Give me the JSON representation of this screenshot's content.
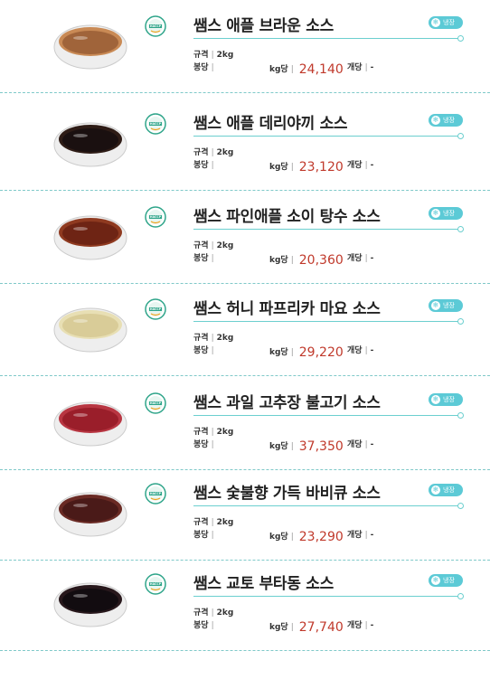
{
  "labels": {
    "spec": "규격",
    "bag": "봉당",
    "per_kg": "kg당",
    "per_each": "개당",
    "dash": "-",
    "haccp": "HACCP"
  },
  "products": [
    {
      "name": "쌤스 애플 브라운 소스",
      "spec": "2kg",
      "price": "24,140",
      "storage": "냉장",
      "sauce_color": "#a0643a",
      "rim_color": "#c98a55"
    },
    {
      "name": "쌤스 애플 데리야끼 소스",
      "spec": "2kg",
      "price": "23,120",
      "storage": "냉장",
      "sauce_color": "#1a1010",
      "rim_color": "#2e1c16"
    },
    {
      "name": "쌤스 파인애플 소이 탕수 소스",
      "spec": "2kg",
      "price": "20,360",
      "storage": "냉장",
      "sauce_color": "#6e2414",
      "rim_color": "#8f3a20"
    },
    {
      "name": "쌤스 허니 파프리카 마요 소스",
      "spec": "2kg",
      "price": "29,220",
      "storage": "냉장",
      "sauce_color": "#d9cc98",
      "rim_color": "#e8dfb4"
    },
    {
      "name": "쌤스 과일 고추장 불고기 소스",
      "spec": "2kg",
      "price": "37,350",
      "storage": "냉장",
      "sauce_color": "#9a1e2a",
      "rim_color": "#b83642"
    },
    {
      "name": "쌤스 숯불향 가득 바비큐 소스",
      "spec": "2kg",
      "price": "23,290",
      "storage": "냉장",
      "sauce_color": "#4a1a18",
      "rim_color": "#6a2a24"
    },
    {
      "name": "쌤스 교토 부타동 소스",
      "spec": "2kg",
      "price": "27,740",
      "storage": "냉장",
      "sauce_color": "#120c10",
      "rim_color": "#28181c"
    }
  ]
}
